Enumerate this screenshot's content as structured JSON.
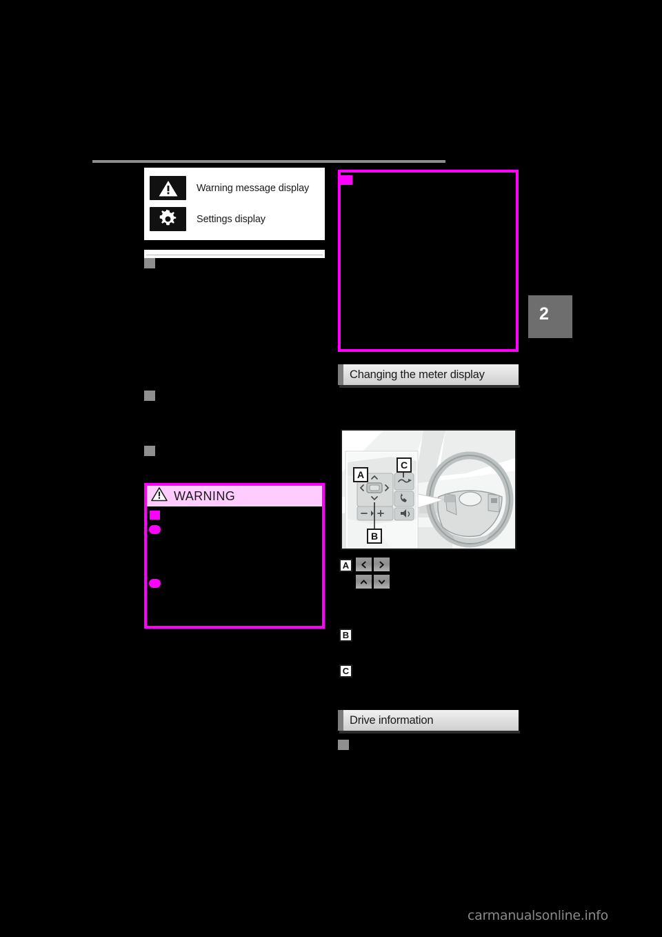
{
  "page": {
    "chapter_tab": "2",
    "watermark": "carmanualsonline.info"
  },
  "left_column": {
    "icon_table": {
      "rows": [
        {
          "icon": "warning-triangle-icon",
          "label": "Warning message display"
        },
        {
          "icon": "gear-icon",
          "label": "Settings display"
        }
      ]
    },
    "warning_box": {
      "title": "WARNING",
      "icon": "warning-triangle-icon",
      "markers": [
        {
          "type": "square",
          "color": "#ff00ff"
        },
        {
          "type": "bullet",
          "color": "#ff00ff"
        },
        {
          "type": "bullet",
          "color": "#ff00ff"
        }
      ]
    },
    "subsection_bullets": [
      {
        "marker": "square",
        "color": "#8f8f8f"
      },
      {
        "marker": "square",
        "color": "#8f8f8f"
      },
      {
        "marker": "square",
        "color": "#8f8f8f"
      }
    ]
  },
  "right_column": {
    "note_box": {
      "marker": "square",
      "color": "#ff00ff"
    },
    "sections": [
      {
        "title": "Changing the meter display"
      },
      {
        "title": "Drive information"
      }
    ],
    "illustration": {
      "name": "steering-wheel-switches-illustration",
      "callouts": [
        "A",
        "B",
        "C"
      ]
    },
    "callout_rows": [
      {
        "letter": "A",
        "buttons": [
          {
            "icon": "arrow-left-icon",
            "glyph": "‹"
          },
          {
            "icon": "arrow-right-icon",
            "glyph": "›"
          },
          {
            "icon": "arrow-up-icon",
            "glyph": "˄"
          },
          {
            "icon": "arrow-down-icon",
            "glyph": "˅"
          }
        ]
      },
      {
        "letter": "B",
        "buttons": []
      },
      {
        "letter": "C",
        "buttons": []
      }
    ],
    "drive_info_bullet": {
      "marker": "square",
      "color": "#8f8f8f"
    }
  },
  "colors": {
    "magenta": "#ff00ff",
    "magenta_light": "#ffccff",
    "gray_marker": "#8f8f8f",
    "tab_gray": "#6e6e6e"
  }
}
